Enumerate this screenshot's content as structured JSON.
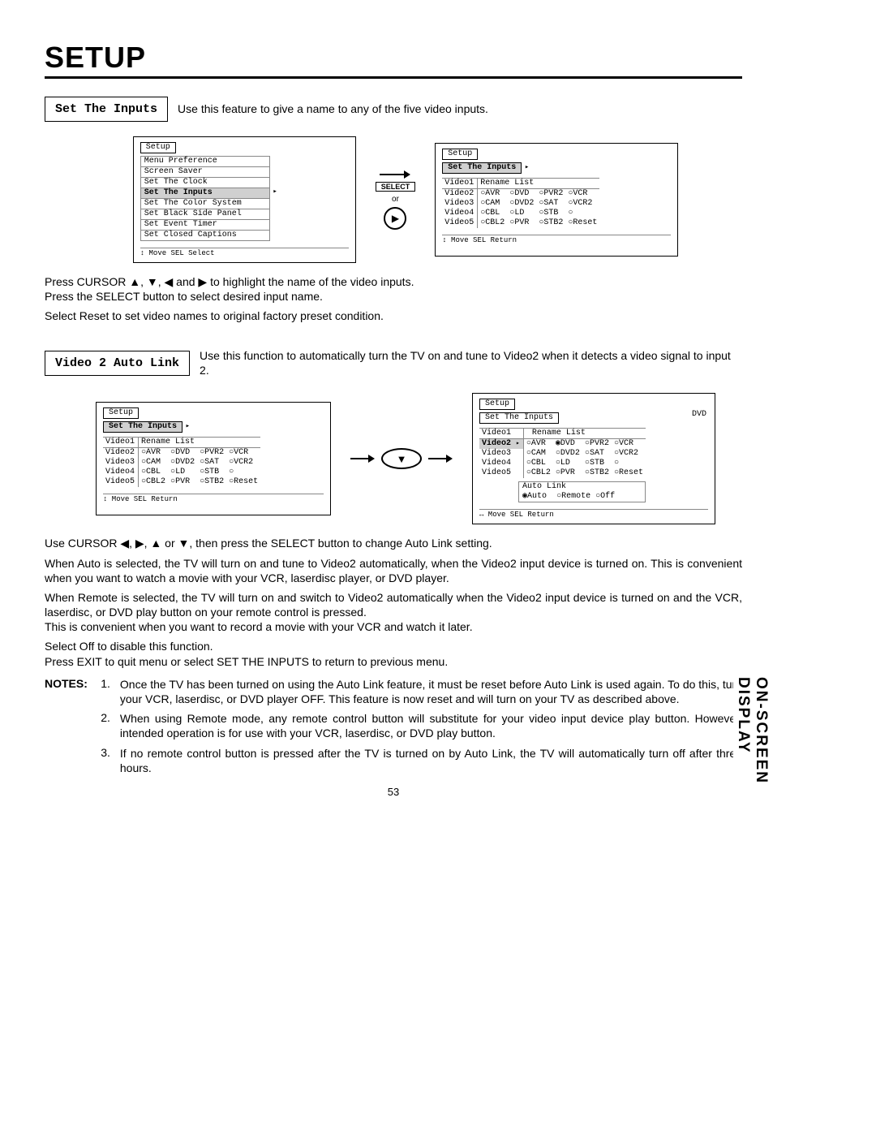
{
  "page_title": "SETUP",
  "side_tab": "ON-SCREEN DISPLAY",
  "page_number": "53",
  "section1": {
    "box_label": "Set The Inputs",
    "intro": "Use this feature to give a name to any of the five video inputs.",
    "osd_left": {
      "title": "Setup",
      "menu_items": [
        "Menu Preference",
        "Screen Saver",
        "Set The Clock",
        "Set The Inputs",
        "Set The Color System",
        "Set Black Side Panel",
        "Set Event Timer",
        "Set Closed Captions"
      ],
      "highlight_idx": 3,
      "footer": "↕ Move  SEL Select"
    },
    "connector": {
      "select": "SELECT",
      "or": "or",
      "play": "▶"
    },
    "osd_right": {
      "title": "Setup",
      "subtitle": "Set The Inputs",
      "row_labels": [
        "Video1",
        "Video2",
        "Video3",
        "Video4",
        "Video5"
      ],
      "row1_text": "Rename List",
      "rows": [
        [
          "AVR",
          "DVD",
          "PVR2",
          "VCR"
        ],
        [
          "CAM",
          "DVD2",
          "SAT",
          "VCR2"
        ],
        [
          "CBL",
          "LD",
          "STB",
          ""
        ],
        [
          "CBL2",
          "PVR",
          "STB2",
          "Reset"
        ]
      ],
      "footer": "↕ Move  SEL Return"
    },
    "paras": [
      "Press CURSOR ▲, ▼, ◀ and ▶ to highlight the name of the video inputs.",
      "Press the SELECT button to select desired input name.",
      "Select Reset to set video names to original factory preset condition."
    ]
  },
  "section2": {
    "box_label": "Video 2 Auto Link",
    "intro": "Use this function to automatically turn the TV on and tune to Video2 when it detects a video signal to input 2.",
    "osd_left": {
      "title": "Setup",
      "subtitle": "Set The Inputs",
      "row_labels": [
        "Video1",
        "Video2",
        "Video3",
        "Video4",
        "Video5"
      ],
      "row1_text": "Rename List",
      "rows": [
        [
          "AVR",
          "DVD",
          "PVR2",
          "VCR"
        ],
        [
          "CAM",
          "DVD2",
          "SAT",
          "VCR2"
        ],
        [
          "CBL",
          "LD",
          "STB",
          ""
        ],
        [
          "CBL2",
          "PVR",
          "STB2",
          "Reset"
        ]
      ],
      "footer": "↕ Move  SEL Return"
    },
    "osd_right": {
      "title": "Setup",
      "subtitle": "Set The Inputs",
      "corner_label": "DVD",
      "row_labels": [
        "Video1",
        "Video2",
        "Video3",
        "Video4",
        "Video5"
      ],
      "row1_text": "Rename List",
      "highlight_row": 1,
      "selected_option": "DVD",
      "rows": [
        [
          "AVR",
          "DVD",
          "PVR2",
          "VCR"
        ],
        [
          "CAM",
          "DVD2",
          "SAT",
          "VCR2"
        ],
        [
          "CBL",
          "LD",
          "STB",
          ""
        ],
        [
          "CBL2",
          "PVR",
          "STB2",
          "Reset"
        ]
      ],
      "autolink": {
        "title": "Auto Link",
        "options": [
          "Auto",
          "Remote",
          "Off"
        ],
        "selected": "Auto"
      },
      "footer": "↔ Move  SEL Return"
    },
    "paras": [
      "Use CURSOR ◀, ▶, ▲ or ▼, then press the SELECT button to change Auto Link setting.",
      "When Auto is selected, the TV will turn on and tune to Video2 automatically, when the Video2 input device is turned on. This is convenient when you want to watch a movie with your VCR, laserdisc player, or DVD player.",
      "When Remote is selected, the TV will turn on and switch to Video2 automatically when the Video2 input device is turned on and the VCR, laserdisc, or DVD play button on your remote control is pressed.",
      "This is convenient when you want to record a movie with your VCR and watch it later.",
      "Select Off to disable this function.",
      "Press EXIT to quit menu or select SET THE INPUTS to return to previous menu."
    ]
  },
  "notes": {
    "label": "NOTES:",
    "items": [
      "Once the TV has been turned on using the Auto Link feature, it must be reset before Auto Link is used again. To do this, turn your VCR, laserdisc, or DVD player OFF. This feature is now reset and will turn on your TV as described above.",
      "When using Remote mode, any remote control button will substitute for your video input device play button. However, intended operation is for use with your VCR, laserdisc, or DVD play button.",
      "If no remote control button is pressed after the TV is turned on by Auto Link, the TV will automatically turn off after three hours."
    ]
  }
}
